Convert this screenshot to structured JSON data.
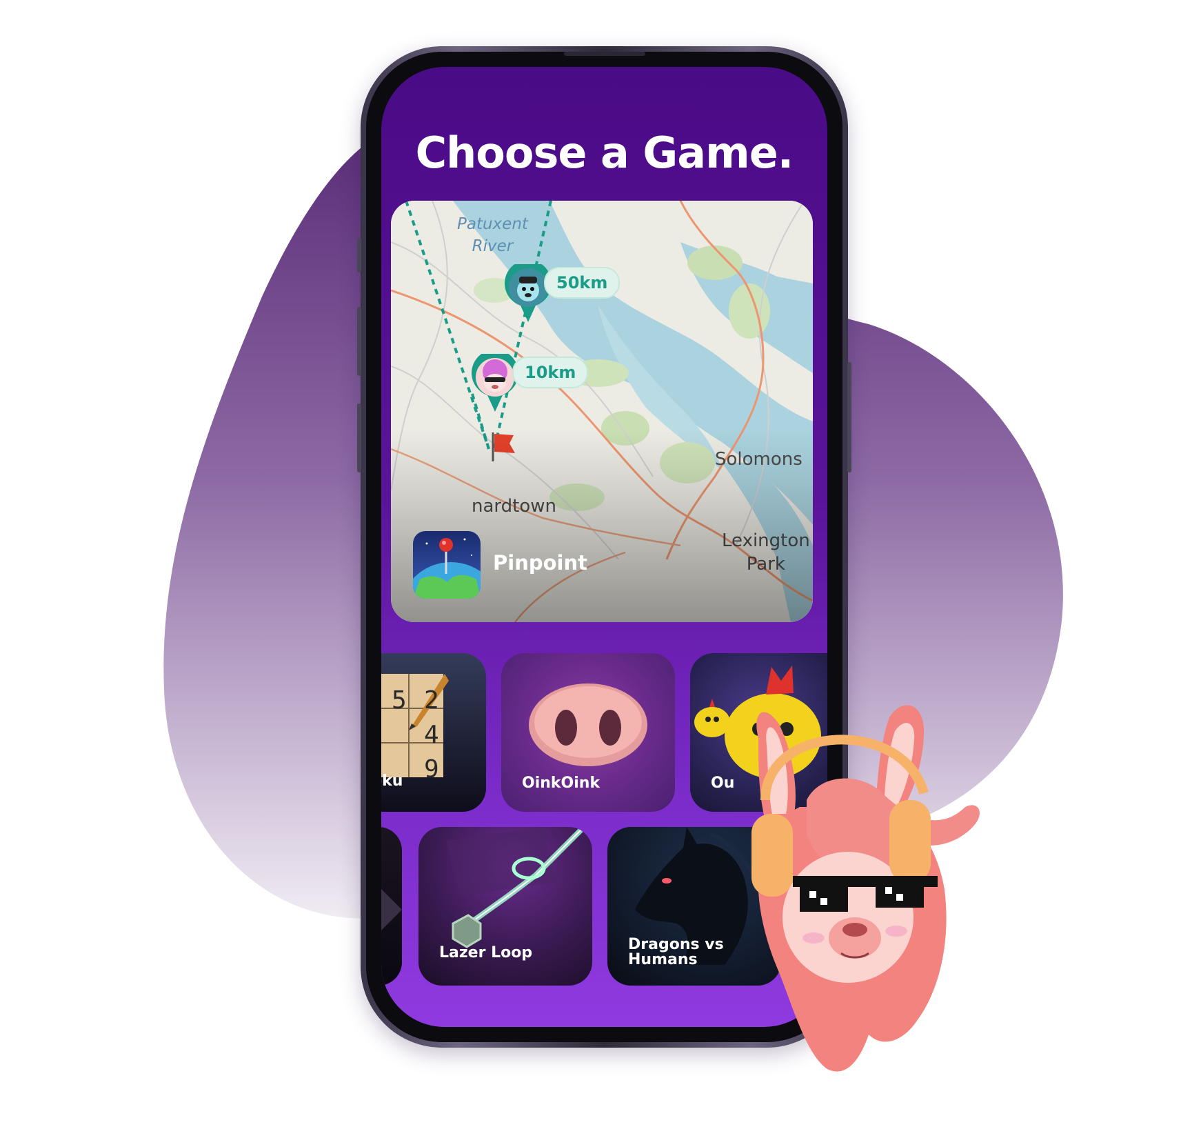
{
  "screen": {
    "title": "Choose a Game."
  },
  "featured_game": {
    "name": "Pinpoint",
    "map": {
      "river_label": "Patuxent\nRiver",
      "places": [
        "nardtown",
        "Solomons",
        "Lexington\nPark"
      ],
      "distance_labels": [
        "50km",
        "10km"
      ]
    }
  },
  "games_row_1": [
    {
      "name": "oku",
      "icon": "sudoku-grid-icon",
      "digits": [
        "5",
        "2",
        "4",
        "9"
      ]
    },
    {
      "name": "OinkOink",
      "icon": "pig-snout-icon"
    },
    {
      "name": "Ou",
      "icon": "chick-icon"
    }
  ],
  "games_row_2": [
    {
      "name": "Lazer Loop",
      "icon": "laser-loop-icon"
    },
    {
      "name": "Dragons vs\nHumans",
      "icon": "dragon-head-icon"
    }
  ],
  "colors": {
    "screen_top": "#4a0b86",
    "screen_bottom": "#8f3ae0",
    "accent_teal": "#1a9c88",
    "blob_top": "#5a2c78",
    "llama_pink": "#f3837f"
  }
}
